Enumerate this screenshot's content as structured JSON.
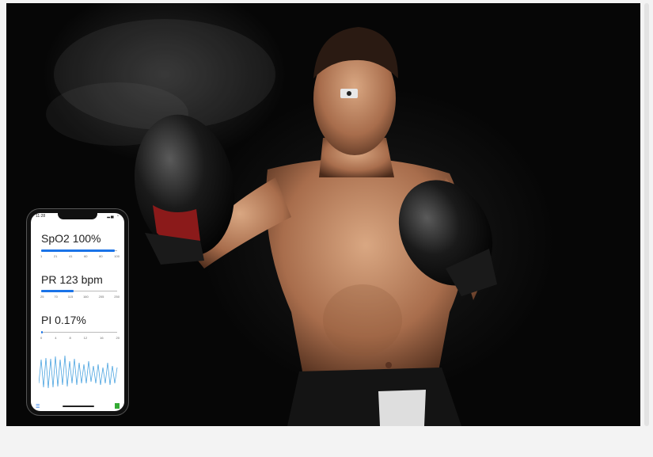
{
  "photo": {
    "alt": "boxer with forehead sensor"
  },
  "phone": {
    "status_time": "11:28",
    "spo2_label": "SpO2 100%",
    "spo2_fill": 0.97,
    "spo2_ticks": [
      "1",
      "21",
      "41",
      "60",
      "80",
      "100"
    ],
    "pr_label": "PR 123 bpm",
    "pr_fill": 0.43,
    "pr_ticks": [
      "25",
      "70",
      "115",
      "160",
      "205",
      "250"
    ],
    "pi_label": "PI 0.17%",
    "pi_fill": 0.01,
    "pi_ticks": [
      "0",
      "4",
      "8",
      "12",
      "16",
      "20"
    ],
    "menu_icon": "menu-icon",
    "battery_icon": "battery-icon"
  }
}
